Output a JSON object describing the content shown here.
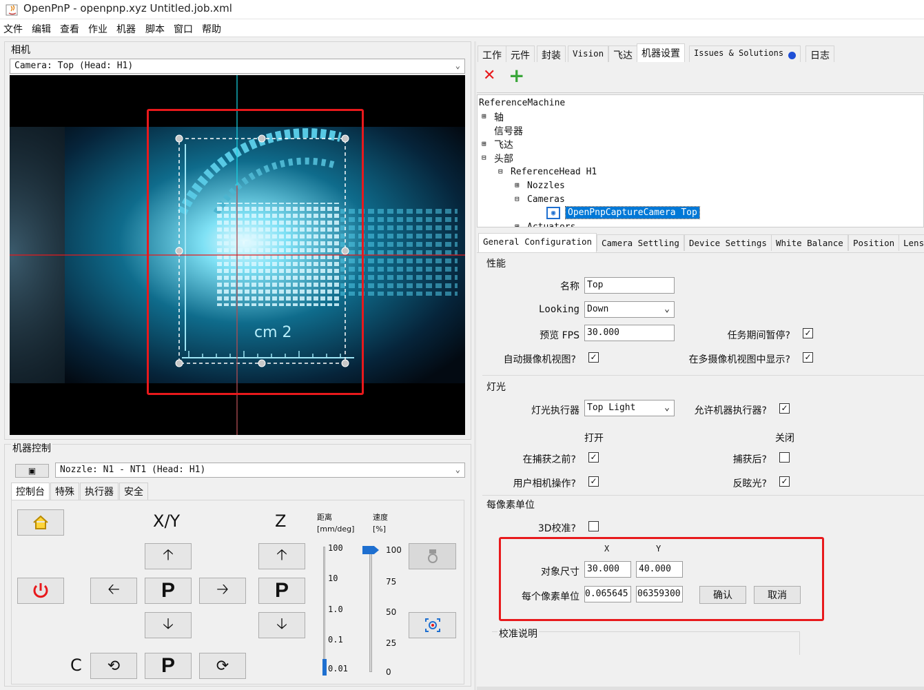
{
  "window": {
    "title": "OpenPnP - openpnp.xyz Untitled.job.xml"
  },
  "menu": [
    "文件",
    "编辑",
    "查看",
    "作业",
    "机器",
    "脚本",
    "窗口",
    "帮助"
  ],
  "camera_panel": {
    "title": "相机",
    "selected_camera": "Camera: Top (Head: H1)",
    "preview_label": "cm 2"
  },
  "machine_control": {
    "title": "机器控制",
    "nozzle_selected": "Nozzle: N1 - NT1 (Head: H1)",
    "tabs": [
      "控制台",
      "特殊",
      "执行器",
      "安全"
    ],
    "xy_label": "X/Y",
    "z_label": "Z",
    "c_label": "C",
    "park_label": "P",
    "distance_header": "距离",
    "distance_unit": "[mm/deg]",
    "speed_header": "速度",
    "speed_unit": "[%]",
    "distance_ticks": [
      "100",
      "10",
      "1.0",
      "0.1",
      "0.01"
    ],
    "speed_ticks": [
      "100",
      "75",
      "50",
      "25",
      "0"
    ],
    "distance_level": 0.01,
    "speed_level": 100
  },
  "right_tabs": [
    "工作",
    "元件",
    "封装",
    "Vision",
    "飞达",
    "机器设置",
    "Issues & Solutions",
    "日志"
  ],
  "tree": {
    "root": "ReferenceMachine",
    "items": [
      "轴",
      "信号器",
      "飞达",
      "头部",
      "ReferenceHead H1",
      "Nozzles",
      "Cameras",
      "OpenPnpCaptureCamera Top",
      "Actuators"
    ]
  },
  "config_tabs": [
    "General Configuration",
    "Camera Settling",
    "Device Settings",
    "White Balance",
    "Position",
    "Lens"
  ],
  "properties": {
    "section": "性能",
    "name_label": "名称",
    "name_value": "Top",
    "looking_label": "Looking",
    "looking_value": "Down",
    "fps_label": "预览 FPS",
    "fps_value": "30.000",
    "pause_label": "任务期间暂停?",
    "pause_checked": true,
    "auto_label": "自动摄像机视图?",
    "auto_checked": true,
    "multi_label": "在多摄像机视图中显示?",
    "multi_checked": true
  },
  "light": {
    "section": "灯光",
    "actuator_label": "灯光执行器",
    "actuator_value": "Top Light",
    "allow_label": "允许机器执行器?",
    "allow_checked": true,
    "on_header": "打开",
    "off_header": "关闭",
    "before_label": "在捕获之前?",
    "before_checked": true,
    "after_label": "捕获后?",
    "after_checked": false,
    "user_label": "用户相机操作?",
    "user_checked": true,
    "antiglare_label": "反眩光?",
    "antiglare_checked": true
  },
  "units_per_pixel": {
    "section": "每像素单位",
    "cal3d_label": "3D校准?",
    "cal3d_checked": false,
    "x_header": "X",
    "y_header": "Y",
    "object_label": "对象尺寸",
    "object_x": "30.000",
    "object_y": "40.000",
    "upp_label": "每个像素单位",
    "upp_x": "0.065645",
    "upp_y": "06359300",
    "confirm_label": "确认",
    "cancel_label": "取消",
    "instructions_label": "校准说明"
  },
  "colors": {
    "accent_red": "#e8191c",
    "selection_blue": "#0078d7",
    "add_green": "#3aa63a"
  }
}
